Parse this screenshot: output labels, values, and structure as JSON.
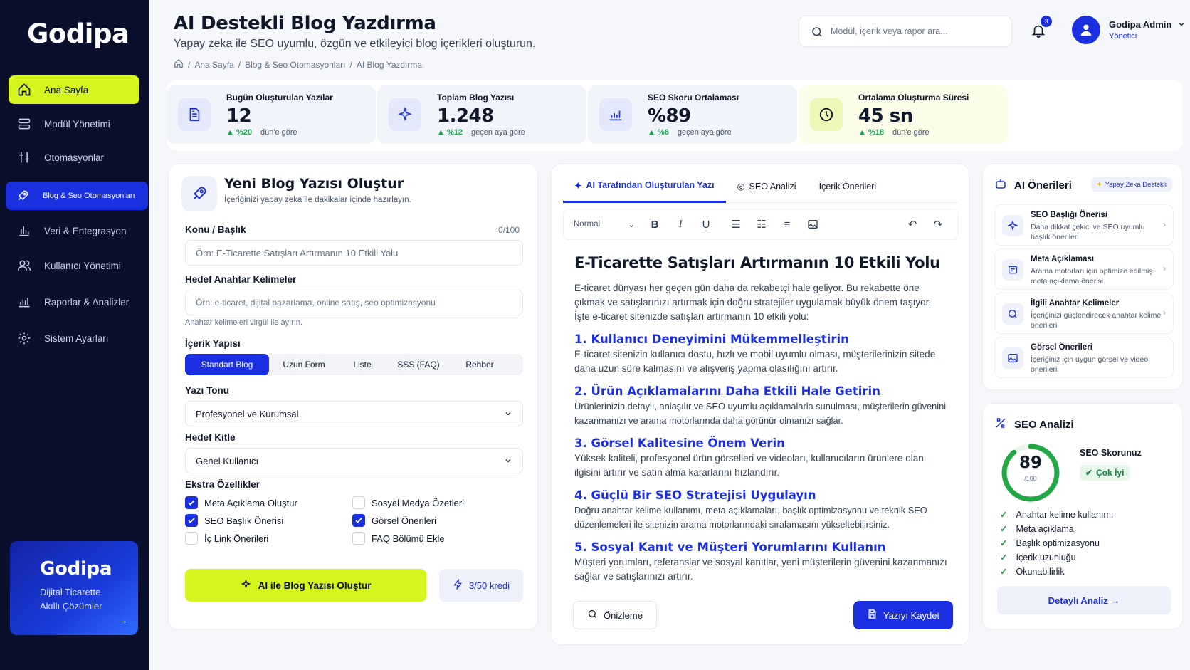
{
  "app": {
    "logo": "Godipa"
  },
  "sidebar": {
    "items": [
      {
        "label": "Ana Sayfa"
      },
      {
        "label": "Modül Yönetimi"
      },
      {
        "label": "Otomasyonlar"
      },
      {
        "label": "Blog & Seo Otomasyonları"
      },
      {
        "label": "Veri & Entegrasyon"
      },
      {
        "label": "Kullanıcı Yönetimi"
      },
      {
        "label": "Raporlar & Analizler"
      },
      {
        "label": "Sistem Ayarları"
      }
    ],
    "promo": {
      "title": "Godipa",
      "line1": "Dijital Ticarette",
      "line2": "Akıllı Çözümler",
      "arrow": "→"
    }
  },
  "header": {
    "title": "AI Destekli Blog Yazdırma",
    "subtitle": "Yapay zeka ile SEO uyumlu, özgün ve etkileyici blog içerikleri oluşturun.",
    "breadcrumb": [
      "Ana Sayfa",
      "Blog & Seo Otomasyonları",
      "AI Blog Yazdırma"
    ],
    "search_placeholder": "Modül, içerik veya rapor ara...",
    "notifications": "3",
    "user": {
      "name": "Godipa Admin",
      "role": "Yönetici"
    }
  },
  "stats": [
    {
      "label": "Bugün Oluşturulan Yazılar",
      "value": "12",
      "delta": "%20",
      "compare": "dün'e göre"
    },
    {
      "label": "Toplam Blog Yazısı",
      "value": "1.248",
      "delta": "%12",
      "compare": "geçen aya göre"
    },
    {
      "label": "SEO Skoru Ortalaması",
      "value": "%89",
      "delta": "%6",
      "compare": "geçen aya göre"
    },
    {
      "label": "Ortalama Oluşturma Süresi",
      "value": "45 sn",
      "delta": "%18",
      "compare": "dün'e göre"
    }
  ],
  "form": {
    "title": "Yeni Blog Yazısı Oluştur",
    "subtitle": "İçeriğinizi yapay zeka ile dakikalar içinde hazırlayın.",
    "topic_label": "Konu / Başlık",
    "topic_counter": "0/100",
    "topic_placeholder": "Örn: E-Ticarette Satışları Artırmanın 10 Etkili Yolu",
    "keywords_label": "Hedef Anahtar Kelimeler",
    "keywords_placeholder": "Örn: e-ticaret, dijital pazarlama, online satış, seo optimizasyonu",
    "keywords_hint": "Anahtar kelimeleri virgül ile ayırın.",
    "structure_label": "İçerik Yapısı",
    "structures": [
      "Standart Blog",
      "Uzun Form",
      "Liste",
      "SSS (FAQ)",
      "Rehber"
    ],
    "tone_label": "Yazı Tonu",
    "tone_value": "Profesyonel ve Kurumsal",
    "audience_label": "Hedef Kitle",
    "audience_value": "Genel Kullanıcı",
    "extras_label": "Ekstra Özellikler",
    "extras": [
      {
        "label": "Meta Açıklama Oluştur",
        "checked": true
      },
      {
        "label": "Sosyal Medya Özetleri",
        "checked": false
      },
      {
        "label": "SEO Başlık Önerisi",
        "checked": true
      },
      {
        "label": "Görsel Önerileri",
        "checked": true
      },
      {
        "label": "İç Link Önerileri",
        "checked": false
      },
      {
        "label": "FAQ Bölümü Ekle",
        "checked": false
      }
    ],
    "generate_label": "AI ile Blog Yazısı Oluştur",
    "credits": "3/50 kredi"
  },
  "editor": {
    "tabs": [
      "AI Tarafından Oluşturulan Yazı",
      "SEO Analizi",
      "İçerik Önerileri"
    ],
    "format": "Normal",
    "title": "E-Ticarette Satışları Artırmanın 10 Etkili Yolu",
    "intro": "E-ticaret dünyası her geçen gün daha da rekabetçi hale geliyor. Bu rekabette öne çıkmak ve satışlarınızı artırmak için doğru stratejiler uygulamak büyük önem taşıyor. İşte e-ticaret sitenizde satışları artırmanın 10 etkili yolu:",
    "sections": [
      {
        "h": "1. Kullanıcı Deneyimini Mükemmelleştirin",
        "p": "E-ticaret sitenizin kullanıcı dostu, hızlı ve mobil uyumlu olması, müşterilerinizin sitede daha uzun süre kalmasını ve alışveriş yapma olasılığını artırır."
      },
      {
        "h": "2. Ürün Açıklamalarını Daha Etkili Hale Getirin",
        "p": "Ürünlerinizin detaylı, anlaşılır ve SEO uyumlu açıklamalarla sunulması, müşterilerin güvenini kazanmanızı ve arama motorlarında daha görünür olmanızı sağlar."
      },
      {
        "h": "3. Görsel Kalitesine Önem Verin",
        "p": "Yüksek kaliteli, profesyonel ürün görselleri ve videoları, kullanıcıların ürünlere olan ilgisini artırır ve satın alma kararlarını hızlandırır."
      },
      {
        "h": "4. Güçlü Bir SEO Stratejisi Uygulayın",
        "p": "Doğru anahtar kelime kullanımı, meta açıklamaları, başlık optimizasyonu ve teknik SEO düzenlemeleri ile sitenizin arama motorlarındaki sıralamasını yükseltebilirsiniz."
      },
      {
        "h": "5. Sosyal Kanıt ve Müşteri Yorumlarını Kullanın",
        "p": "Müşteri yorumları, referanslar ve sosyal kanıtlar, yeni müşterilerin güvenini kazanmanızı sağlar ve satışlarınızı artırır."
      }
    ],
    "preview_label": "Önizleme",
    "save_label": "Yazıyı Kaydet"
  },
  "ai_suggestions": {
    "title": "AI Önerileri",
    "badge": "Yapay Zeka Destekli",
    "items": [
      {
        "title": "SEO Başlığı Önerisi",
        "desc": "Daha dikkat çekici ve SEO uyumlu başlık önerileri"
      },
      {
        "title": "Meta Açıklaması",
        "desc": "Arama motorları için optimize edilmiş meta açıklama önerisi"
      },
      {
        "title": "İlgili Anahtar Kelimeler",
        "desc": "İçeriğinizi güçlendirecek anahtar kelime önerileri"
      },
      {
        "title": "Görsel Önerileri",
        "desc": "İçeriğiniz için uygun görsel ve video önerileri"
      }
    ]
  },
  "seo": {
    "title": "SEO Analizi",
    "score": "89",
    "score_max": "/100",
    "score_value": 89,
    "score_label": "SEO Skorunuz",
    "rating": "Çok İyi",
    "checks": [
      "Anahtar kelime kullanımı",
      "Meta açıklama",
      "Başlık optimizasyonu",
      "İçerik uzunluğu",
      "Okunabilirlik"
    ],
    "detail_label": "Detaylı Analiz →"
  },
  "colors": {
    "accent": "#1a2fe0",
    "lime": "#d6f51f",
    "sidebar": "#0a0f2c",
    "success": "#16a34a"
  }
}
